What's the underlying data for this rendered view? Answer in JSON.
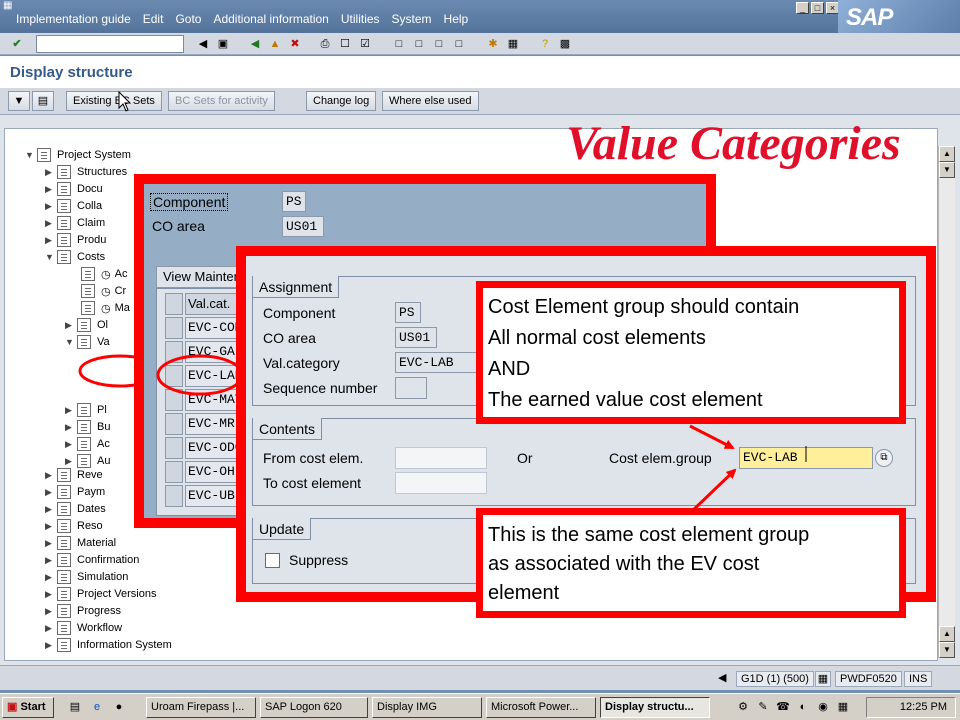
{
  "menu": {
    "items": [
      "Implementation guide",
      "Edit",
      "Goto",
      "Additional information",
      "Utilities",
      "System",
      "Help"
    ],
    "brand": "SAP"
  },
  "title": "Display structure",
  "app_toolbar": {
    "existing_bc_sets": "Existing BC Sets",
    "bc_sets_for_activity": "BC Sets for activity",
    "change_log": "Change log",
    "where_else_used": "Where else used"
  },
  "heading": "Value Categories",
  "tree": {
    "root": "Project System",
    "items": [
      "Structures",
      "Docu",
      "Colla",
      "Claim",
      "Produ",
      "Costs",
      "Reve",
      "Paym",
      "Dates",
      "Reso",
      "Material",
      "Confirmation",
      "Simulation",
      "Project Versions",
      "Progress",
      "Workflow",
      "Information System"
    ],
    "sub_items": [
      "Ac",
      "Cr",
      "Ma",
      "Ol",
      "Va",
      "Pl",
      "Bu",
      "Ac",
      "Au"
    ]
  },
  "dialog1": {
    "component_label": "Component",
    "component_value": "PS",
    "co_area_label": "CO area",
    "co_area_value": "US01",
    "view_title": "View Mainten",
    "column_header": "Val.cat.",
    "rows": [
      "EVC-COM",
      "EVC-GA",
      "EVC-LAB",
      "EVC-MAT",
      "EVC-MR",
      "EVC-ODC",
      "EVC-OH",
      "EVC-UB"
    ]
  },
  "dialog2": {
    "assignment": {
      "title": "Assignment",
      "component_label": "Component",
      "component_value": "PS",
      "co_area_label": "CO area",
      "co_area_value": "US01",
      "val_category_label": "Val.category",
      "val_category_value": "EVC-LAB",
      "sequence_label": "Sequence number"
    },
    "contents": {
      "title": "Contents",
      "from_label": "From cost elem.",
      "to_label": "To cost element",
      "or_label": "Or",
      "group_label": "Cost elem.group",
      "group_value": "EVC-LAB"
    },
    "update": {
      "title": "Update",
      "suppress_label": "Suppress"
    }
  },
  "callout1": {
    "lines": [
      "Cost Element group should contain",
      "All normal cost elements",
      "AND",
      "The earned value cost element"
    ]
  },
  "callout2": {
    "lines": [
      "This is the same cost element group",
      "as associated with the EV cost",
      "element"
    ]
  },
  "status_bar": {
    "system": "G1D (1) (500)",
    "server": "PWDF0520",
    "mode": "INS"
  },
  "taskbar": {
    "start": "Start",
    "buttons": [
      "Uroam Firepass |...",
      "SAP Logon 620",
      "Display IMG",
      "Microsoft Power...",
      "Display structu..."
    ],
    "clock": "12:25 PM"
  },
  "colors": {
    "accent_red": "#ff0000",
    "heading_red": "#e0102a",
    "sap_blue": "#355a8c"
  }
}
